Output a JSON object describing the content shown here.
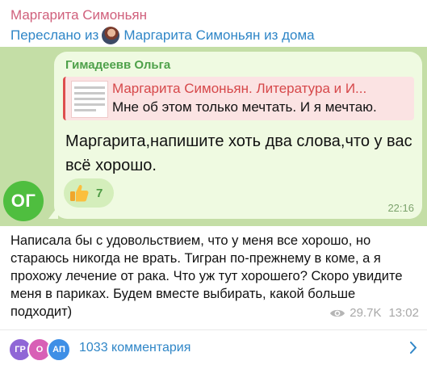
{
  "post": {
    "author": "Маргарита Симоньян",
    "forwarded_prefix": "Переслано из",
    "forwarded_source": "Маргарита Симоньян из дома"
  },
  "forwarded_message": {
    "avatar_initials": "ОГ",
    "sender": "Гимадеевв Ольга",
    "reply": {
      "title": "Маргарита Симоньян. Литература и И...",
      "text": "Мне об этом только мечтать. И я мечтаю."
    },
    "text": "Маргарита,напишите хоть два слова,что у вас всё хорошо.",
    "reaction": {
      "icon": "thumbs-up-icon",
      "count": "7"
    },
    "time": "22:16"
  },
  "reply_text": "Написала бы с удовольствием, что у меня все хорошо, но стараюсь никогда не врать. Тигран по-прежнему в коме, а я прохожу лечение от рака. Что уж тут хорошего? Скоро увидите меня в париках. Будем вместе выбирать, какой больше подходит)",
  "meta": {
    "views": "29.7K",
    "time": "13:02"
  },
  "comments": {
    "avatars": [
      {
        "initials": "ГР",
        "color": "#8f66d6"
      },
      {
        "initials": "О",
        "color": "#d860b6"
      },
      {
        "initials": "АП",
        "color": "#3e8fe6"
      }
    ],
    "label": "1033 комментария"
  }
}
